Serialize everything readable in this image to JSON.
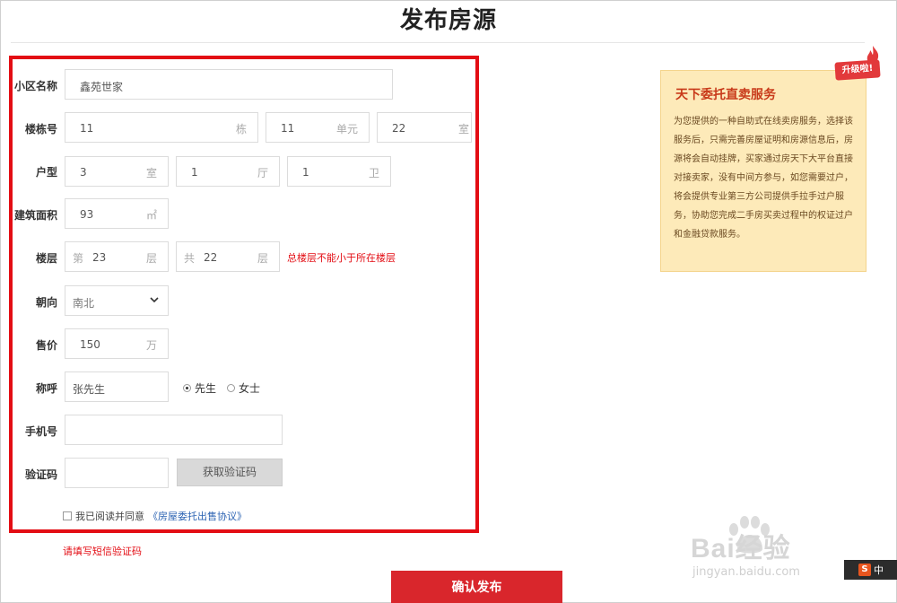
{
  "header": {
    "title": "发布房源"
  },
  "form": {
    "community": {
      "label": "小区名称",
      "value": "鑫苑世家"
    },
    "building": {
      "label": "楼栋号",
      "building_value": "11",
      "building_unit": "栋",
      "unit_value": "11",
      "unit_unit": "单元",
      "room_value": "22",
      "room_unit": "室"
    },
    "layout": {
      "label": "户型",
      "rooms_value": "3",
      "rooms_unit": "室",
      "halls_value": "1",
      "halls_unit": "厅",
      "baths_value": "1",
      "baths_unit": "卫"
    },
    "area": {
      "label": "建筑面积",
      "value": "93",
      "unit": "㎡"
    },
    "floor": {
      "label": "楼层",
      "floor_prefix": "第",
      "floor_value": "23",
      "floor_unit": "层",
      "total_prefix": "共",
      "total_value": "22",
      "total_unit": "层",
      "error": "总楼层不能小于所在楼层"
    },
    "orientation": {
      "label": "朝向",
      "selected": "南北"
    },
    "price": {
      "label": "售价",
      "value": "150",
      "unit": "万"
    },
    "name": {
      "label": "称呼",
      "value": "张先生",
      "option_mr": "先生",
      "option_ms": "女士",
      "selected": "先生"
    },
    "phone": {
      "label": "手机号",
      "value": ""
    },
    "code": {
      "label": "验证码",
      "value": "",
      "button": "获取验证码"
    },
    "agreement": {
      "text": "我已阅读并同意",
      "link": "《房屋委托出售协议》"
    },
    "sms_error": "请填写短信验证码",
    "submit": "确认发布"
  },
  "promo": {
    "badge": "升级啦!",
    "title": "天下委托直卖服务",
    "body": "为您提供的一种自助式在线卖房服务，选择该服务后，只需完善房屋证明和房源信息后，房源将会自动挂牌，买家通过房天下大平台直接对接卖家，没有中间方参与，如您需要过户，将会提供专业第三方公司提供手拉手过户服务，协助您完成二手房买卖过程中的权证过户和金融贷款服务。"
  },
  "watermark": {
    "brand": "Bai经验",
    "url": "jingyan.baidu.com"
  },
  "ime": {
    "logo": "S",
    "lang": "中"
  },
  "colors": {
    "accent": "#e30d14",
    "button": "#d9262c",
    "promo_bg": "#fdeab9",
    "link": "#2d64b3"
  }
}
